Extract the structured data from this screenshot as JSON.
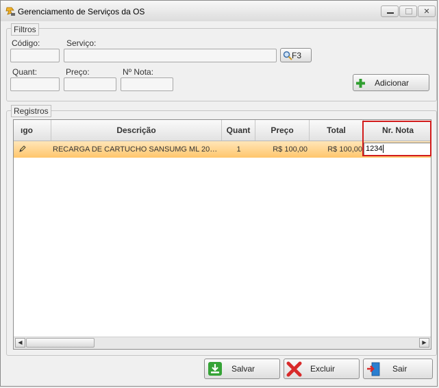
{
  "window": {
    "title": "Gerenciamento de Serviços da OS"
  },
  "filtros": {
    "legend": "Filtros",
    "codigo_label": "Código:",
    "codigo_value": "",
    "servico_label": "Serviço:",
    "servico_value": "",
    "search_button_label": "F3",
    "quant_label": "Quant:",
    "quant_value": "",
    "preco_label": "Preço:",
    "preco_value": "",
    "nota_label": "Nº Nota:",
    "nota_value": "",
    "adicionar_label": "Adicionar"
  },
  "registros": {
    "legend": "Registros",
    "columns": [
      "ıgo",
      "Descrição",
      "Quant",
      "Preço",
      "Total",
      "Nr. Nota"
    ],
    "rows": [
      {
        "codigo": "",
        "descricao": "RECARGA DE CARTUCHO SANSUMG ML 20…",
        "quant": "1",
        "preco": "R$ 100,00",
        "total": "R$ 100,00",
        "nota": "1234"
      }
    ],
    "scrollbar": {
      "left_arrow": "◀",
      "right_arrow": "▶"
    }
  },
  "actions": {
    "salvar": "Salvar",
    "excluir": "Excluir",
    "sair": "Sair"
  },
  "colors": {
    "row_highlight": "#ffc66c",
    "annotation_box": "#d21c1c",
    "add_icon": "#2f9e2f",
    "save_icon": "#35a336",
    "delete_icon": "#d82a2a",
    "exit_icon": "#2b7fd0"
  },
  "icons": [
    "app-icon",
    "search-icon",
    "add-icon",
    "pencil-icon",
    "save-icon",
    "delete-icon",
    "exit-icon"
  ]
}
